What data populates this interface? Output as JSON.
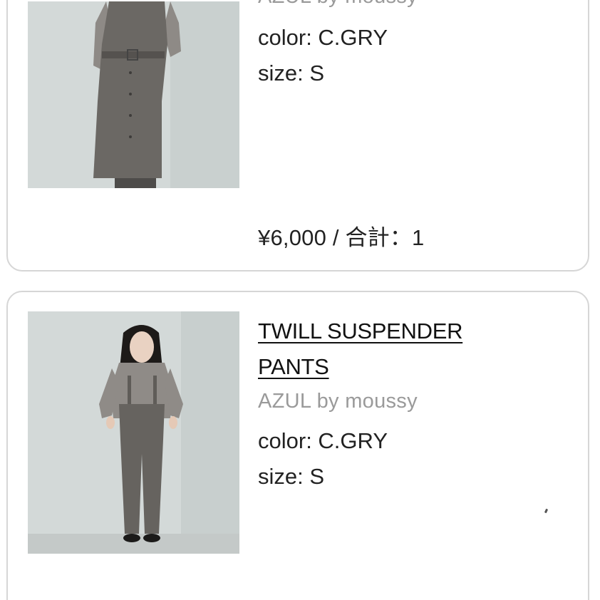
{
  "cart_items": [
    {
      "title": "",
      "brand": "AZUL by moussy",
      "color_label": "color: C.GRY",
      "size_label": "size: S",
      "price_line": "¥6,000 / 合計：1",
      "image_desc": "gray-belted-vest-dress-photo"
    },
    {
      "title_line1": "TWILL SUSPENDER",
      "title_line2": "PANTS",
      "brand": "AZUL by moussy",
      "color_label": "color: C.GRY",
      "size_label": "size: S",
      "image_desc": "gray-suspender-pants-photo"
    }
  ],
  "colors": {
    "card_border": "#d6d6d6",
    "text": "#222222",
    "brand_text": "#9a9a9a",
    "photo_bg": "#cfd6d6",
    "garment_gray": "#6a6763"
  }
}
